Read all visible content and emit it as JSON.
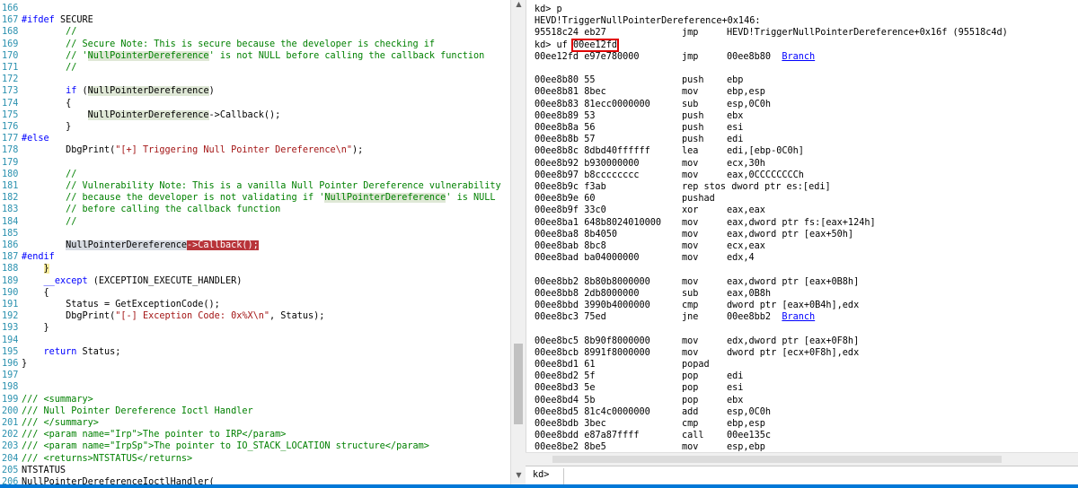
{
  "source": {
    "lines": [
      {
        "n": "166",
        "html": ""
      },
      {
        "n": "167",
        "html": "<span class='kw'>#ifdef</span> SECURE"
      },
      {
        "n": "168",
        "html": "        <span class='cm'>//</span>"
      },
      {
        "n": "169",
        "html": "        <span class='cm'>// Secure Note: This is secure because the developer is checking if</span>"
      },
      {
        "n": "170",
        "html": "        <span class='cm'>// '<span class=\"hlg\">NullPointerDereference</span>' is not NULL before calling the callback function</span>"
      },
      {
        "n": "171",
        "html": "        <span class='cm'>//</span>"
      },
      {
        "n": "172",
        "html": ""
      },
      {
        "n": "173",
        "html": "        <span class='kw'>if</span> (<span class='hlg'>NullPointerDereference</span>)"
      },
      {
        "n": "174",
        "html": "        {"
      },
      {
        "n": "175",
        "html": "            <span class='hlg'>NullPointerDereference</span>->Callback();"
      },
      {
        "n": "176",
        "html": "        }"
      },
      {
        "n": "177",
        "html": "<span class='kw'>#else</span>"
      },
      {
        "n": "178",
        "html": "        DbgPrint(<span class='str'>\"[+] Triggering Null Pointer Dereference\\n\"</span>);"
      },
      {
        "n": "179",
        "html": ""
      },
      {
        "n": "180",
        "html": "        <span class='cm'>//</span>"
      },
      {
        "n": "181",
        "html": "        <span class='cm'>// Vulnerability Note: This is a vanilla Null Pointer Dereference vulnerability</span>"
      },
      {
        "n": "182",
        "html": "        <span class='cm'>// because the developer is not validating if '<span class=\"hlg\">NullPointerDereference</span>' is NULL</span>"
      },
      {
        "n": "183",
        "html": "        <span class='cm'>// before calling the callback function</span>"
      },
      {
        "n": "184",
        "html": "        <span class='cm'>//</span>"
      },
      {
        "n": "185",
        "html": ""
      },
      {
        "n": "186",
        "html": "        <span class='sel'>NullPointerDereference</span><span class='err'>->Callback();</span>"
      },
      {
        "n": "187",
        "html": "<span class='kw'>#endif</span>"
      },
      {
        "n": "188",
        "html": "    <span class='brace'>}</span>"
      },
      {
        "n": "189",
        "html": "    <span class='kw'>__except</span> (EXCEPTION_EXECUTE_HANDLER)"
      },
      {
        "n": "190",
        "html": "    {"
      },
      {
        "n": "191",
        "html": "        Status = GetExceptionCode();"
      },
      {
        "n": "192",
        "html": "        DbgPrint(<span class='str'>\"[-] Exception Code: 0x%X\\n\"</span>, Status);"
      },
      {
        "n": "193",
        "html": "    }"
      },
      {
        "n": "194",
        "html": ""
      },
      {
        "n": "195",
        "html": "    <span class='kw'>return</span> Status;"
      },
      {
        "n": "196",
        "html": "}"
      },
      {
        "n": "197",
        "html": ""
      },
      {
        "n": "198",
        "html": ""
      },
      {
        "n": "199",
        "html": "<span class='cm'>/// &lt;summary&gt;</span>"
      },
      {
        "n": "200",
        "html": "<span class='cm'>/// Null Pointer Dereference Ioctl Handler</span>"
      },
      {
        "n": "201",
        "html": "<span class='cm'>/// &lt;/summary&gt;</span>"
      },
      {
        "n": "202",
        "html": "<span class='cm'>/// &lt;param name=\"Irp\"&gt;The pointer to IRP&lt;/param&gt;</span>"
      },
      {
        "n": "203",
        "html": "<span class='cm'>/// &lt;param name=\"IrpSp\"&gt;The pointer to IO_STACK_LOCATION structure&lt;/param&gt;</span>"
      },
      {
        "n": "204",
        "html": "<span class='cm'>/// &lt;returns&gt;NTSTATUS&lt;/returns&gt;</span>"
      },
      {
        "n": "205",
        "html": "NTSTATUS"
      },
      {
        "n": "206",
        "html": "NullPointerDereferenceIoctlHandler("
      }
    ]
  },
  "disasm": {
    "lines": [
      {
        "a": "",
        "b": "kd> p",
        "c": "",
        "d": ""
      },
      {
        "a": "",
        "b": "HEVD!TriggerNullPointerDereference+0x146:",
        "c": "",
        "d": ""
      },
      {
        "a": "95518c24 eb27",
        "b": "",
        "c": "jmp",
        "d": "HEVD!TriggerNullPointerDereference+0x16f (95518c4d)"
      },
      {
        "a": "kd> uf 00ee12fd",
        "b": "",
        "c": "",
        "d": "",
        "box": true
      },
      {
        "a": "00ee12fd e97e780000",
        "b": "",
        "c": "jmp",
        "d": "00ee8b80",
        "link": "Branch"
      },
      {
        "a": "",
        "b": "",
        "c": "",
        "d": ""
      },
      {
        "a": "00ee8b80 55",
        "b": "",
        "c": "push",
        "d": "ebp"
      },
      {
        "a": "00ee8b81 8bec",
        "b": "",
        "c": "mov",
        "d": "ebp,esp"
      },
      {
        "a": "00ee8b83 81ecc0000000",
        "b": "",
        "c": "sub",
        "d": "esp,0C0h"
      },
      {
        "a": "00ee8b89 53",
        "b": "",
        "c": "push",
        "d": "ebx"
      },
      {
        "a": "00ee8b8a 56",
        "b": "",
        "c": "push",
        "d": "esi"
      },
      {
        "a": "00ee8b8b 57",
        "b": "",
        "c": "push",
        "d": "edi"
      },
      {
        "a": "00ee8b8c 8dbd40ffffff",
        "b": "",
        "c": "lea",
        "d": "edi,[ebp-0C0h]"
      },
      {
        "a": "00ee8b92 b930000000",
        "b": "",
        "c": "mov",
        "d": "ecx,30h"
      },
      {
        "a": "00ee8b97 b8cccccccc",
        "b": "",
        "c": "mov",
        "d": "eax,0CCCCCCCCh"
      },
      {
        "a": "00ee8b9c f3ab",
        "b": "",
        "c": "rep stos dword ptr es:[edi]",
        "d": ""
      },
      {
        "a": "00ee8b9e 60",
        "b": "",
        "c": "pushad",
        "d": ""
      },
      {
        "a": "00ee8b9f 33c0",
        "b": "",
        "c": "xor",
        "d": "eax,eax"
      },
      {
        "a": "00ee8ba1 648b8024010000",
        "b": "",
        "c": "mov",
        "d": "eax,dword ptr fs:[eax+124h]"
      },
      {
        "a": "00ee8ba8 8b4050",
        "b": "",
        "c": "mov",
        "d": "eax,dword ptr [eax+50h]"
      },
      {
        "a": "00ee8bab 8bc8",
        "b": "",
        "c": "mov",
        "d": "ecx,eax"
      },
      {
        "a": "00ee8bad ba04000000",
        "b": "",
        "c": "mov",
        "d": "edx,4"
      },
      {
        "a": "",
        "b": "",
        "c": "",
        "d": ""
      },
      {
        "a": "00ee8bb2 8b80b8000000",
        "b": "",
        "c": "mov",
        "d": "eax,dword ptr [eax+0B8h]"
      },
      {
        "a": "00ee8bb8 2db8000000",
        "b": "",
        "c": "sub",
        "d": "eax,0B8h"
      },
      {
        "a": "00ee8bbd 3990b4000000",
        "b": "",
        "c": "cmp",
        "d": "dword ptr [eax+0B4h],edx"
      },
      {
        "a": "00ee8bc3 75ed",
        "b": "",
        "c": "jne",
        "d": "00ee8bb2",
        "link": "Branch"
      },
      {
        "a": "",
        "b": "",
        "c": "",
        "d": ""
      },
      {
        "a": "00ee8bc5 8b90f8000000",
        "b": "",
        "c": "mov",
        "d": "edx,dword ptr [eax+0F8h]"
      },
      {
        "a": "00ee8bcb 8991f8000000",
        "b": "",
        "c": "mov",
        "d": "dword ptr [ecx+0F8h],edx"
      },
      {
        "a": "00ee8bd1 61",
        "b": "",
        "c": "popad",
        "d": ""
      },
      {
        "a": "00ee8bd2 5f",
        "b": "",
        "c": "pop",
        "d": "edi"
      },
      {
        "a": "00ee8bd3 5e",
        "b": "",
        "c": "pop",
        "d": "esi"
      },
      {
        "a": "00ee8bd4 5b",
        "b": "",
        "c": "pop",
        "d": "ebx"
      },
      {
        "a": "00ee8bd5 81c4c0000000",
        "b": "",
        "c": "add",
        "d": "esp,0C0h"
      },
      {
        "a": "00ee8bdb 3bec",
        "b": "",
        "c": "cmp",
        "d": "ebp,esp"
      },
      {
        "a": "00ee8bdd e87a87ffff",
        "b": "",
        "c": "call",
        "d": "00ee135c"
      },
      {
        "a": "00ee8be2 8be5",
        "b": "",
        "c": "mov",
        "d": "esp,ebp"
      }
    ]
  },
  "command": {
    "prompt": "kd>",
    "value": ""
  }
}
